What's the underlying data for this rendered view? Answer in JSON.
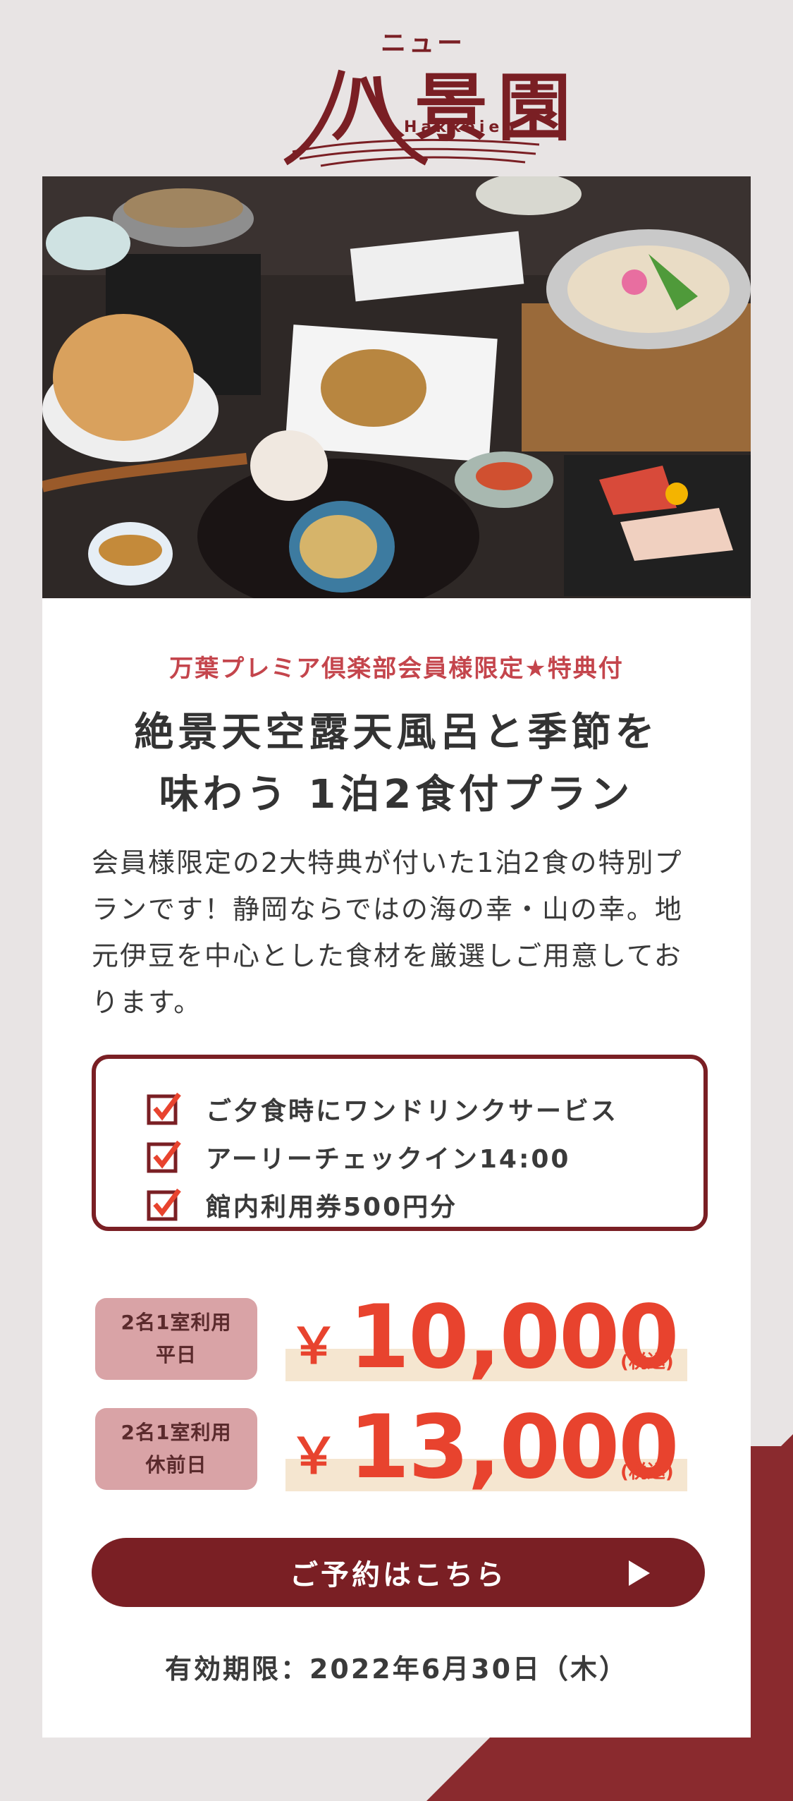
{
  "logo": {
    "top_text": "ニュー",
    "main_text": "八景園",
    "sub_text": "Hakkeien",
    "color": "#7a1f24"
  },
  "hero": {
    "image_description_icon": "food-photo-icon"
  },
  "plan": {
    "tag": "万葉プレミア倶楽部会員様限定★特典付",
    "title_line1": "絶景天空露天風呂と季節を",
    "title_line2": "味わう 1泊2食付プラン",
    "description": "会員様限定の2大特典が付いた1泊2食の特別プランです！静岡ならではの海の幸・山の幸。地元伊豆を中心とした食材を厳選しご用意しております。"
  },
  "perks": [
    {
      "label": "ご夕食時にワンドリンクサービス"
    },
    {
      "label": "アーリーチェックイン14:00"
    },
    {
      "label": "館内利用券500円分"
    }
  ],
  "prices": [
    {
      "badge_line1": "2名1室利用",
      "badge_line2": "平日",
      "yen": "￥",
      "amount": "10,000",
      "tax": "(税込)"
    },
    {
      "badge_line1": "2名1室利用",
      "badge_line2": "休前日",
      "yen": "￥",
      "amount": "13,000",
      "tax": "(税込)"
    }
  ],
  "cta": {
    "label": "ご予約はこちら",
    "icon": "play-arrow-icon"
  },
  "expiry": "有効期限：2022年6月30日（木）",
  "colors": {
    "brand": "#7a1f24",
    "accent_red": "#e8432e",
    "tag_pink": "#c4454c",
    "badge_bg": "#d9a3a6"
  }
}
